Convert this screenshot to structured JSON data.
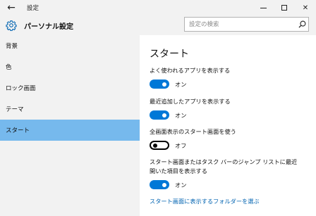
{
  "window": {
    "title": "設定"
  },
  "header": {
    "title": "パーソナル設定",
    "search_placeholder": "設定の検索"
  },
  "sidebar": {
    "items": [
      {
        "label": "背景"
      },
      {
        "label": "色"
      },
      {
        "label": "ロック画面"
      },
      {
        "label": "テーマ"
      },
      {
        "label": "スタート"
      }
    ],
    "active": "スタート"
  },
  "content": {
    "title": "スタート",
    "settings": [
      {
        "label": "よく使われるアプリを表示する",
        "state": "オン"
      },
      {
        "label": "最近追加したアプリを表示する",
        "state": "オン"
      },
      {
        "label": "全画面表示のスタート画面を使う",
        "state": "オフ"
      },
      {
        "label": "スタート画面またはタスク バーのジャンプ リストに最近開いた項目を表示する",
        "state": "オン"
      }
    ],
    "link": "スタート画面に表示するフォルダーを選ぶ"
  },
  "colors": {
    "accent": "#0078d7",
    "selected_nav": "#76b9ed",
    "link": "#0063b1"
  }
}
